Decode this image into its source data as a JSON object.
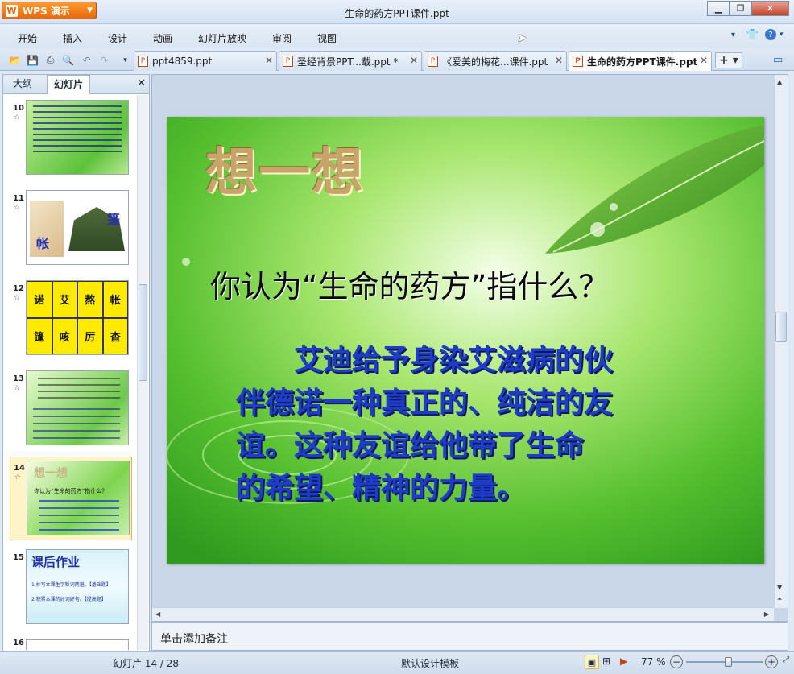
{
  "app": {
    "badge": "WPS 演示",
    "window_title": "生命的药方PPT课件.ppt"
  },
  "menu": [
    "开始",
    "插入",
    "设计",
    "动画",
    "幻灯片放映",
    "审阅",
    "视图"
  ],
  "tabs": [
    {
      "label": "ppt4859.ppt"
    },
    {
      "label": "圣经背景PPT...载.ppt *"
    },
    {
      "label": "《爱美的梅花...课件.ppt"
    },
    {
      "label": "生命的药方PPT课件.ppt"
    }
  ],
  "panel": {
    "tab_outline": "大纲",
    "tab_slides": "幻灯片"
  },
  "thumbs": {
    "n10": "10",
    "n11": "11",
    "n12": "12",
    "n13": "13",
    "n14": "14",
    "n15": "15",
    "n16": "16",
    "s11": [
      "篷",
      "帐"
    ],
    "grid": [
      "诺",
      "艾",
      "熬",
      "帐",
      "篷",
      "咳",
      "厉",
      "杳"
    ],
    "s15_title": "课后作业",
    "s15_items": [
      "1.抄写本课生字新词两遍。【基础题】",
      "2.积累本课的好词好句。【提高题】"
    ],
    "s14_title": "想一想",
    "s14_question": "你认为“生命的药方”指什么？"
  },
  "slide": {
    "title": "想一想",
    "question": "你认为“生命的药方”指什么？",
    "answer_lines": [
      "艾迪给予身染艾滋病的伙",
      "伴德诺一种真正的、纯洁的友",
      "谊。这种友谊给他带了生命",
      "的希望、精神的力量。"
    ]
  },
  "notes_placeholder": "单击添加备注",
  "status": {
    "slide_counter": "幻灯片 14 / 28",
    "template": "默认设计模板",
    "zoom": "77 %",
    "zoom_value": 0.77
  },
  "colors": {
    "accent": "#e8680a",
    "answer_text": "#1e3cc8",
    "slide_green": "#5cc23a"
  }
}
